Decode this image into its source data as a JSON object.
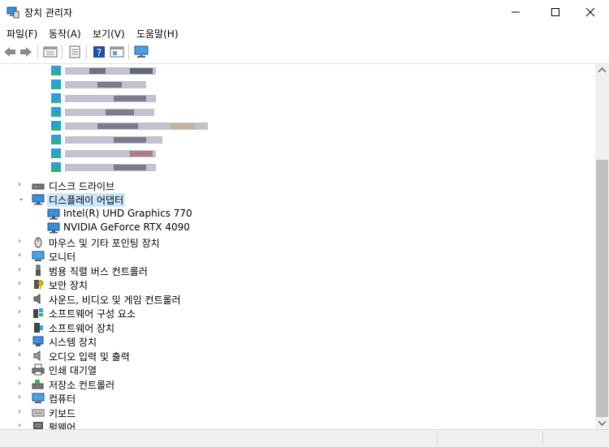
{
  "window": {
    "title": "장치 관리자",
    "minimize_symbol": "—",
    "maximize_symbol": "☐",
    "close_symbol": "✕"
  },
  "menu": [
    "파일(F)",
    "동작(A)",
    "보기(V)",
    "도움말(H)"
  ],
  "toolbar": {
    "buttons": [
      "back-icon",
      "forward-icon",
      "properties-sheet-icon",
      "view-icon",
      "help-icon",
      "update-driver-icon",
      "monitor-scan-icon"
    ]
  },
  "tree": {
    "blurred_items": [
      {
        "icon": "network-adapter-icon",
        "label": "(blurred)"
      },
      {
        "icon": "network-adapter-icon",
        "label": "(blurred)"
      },
      {
        "icon": "network-adapter-icon",
        "label": "(blurred)"
      },
      {
        "icon": "network-adapter-icon",
        "label": "(blurred)"
      },
      {
        "icon": "network-adapter-icon",
        "label": "(blurred)"
      },
      {
        "icon": "network-adapter-icon",
        "label": "(blurred)"
      },
      {
        "icon": "network-adapter-icon",
        "label": "(blurred)"
      },
      {
        "icon": "network-adapter-icon",
        "label": "(blurred)"
      }
    ],
    "categories": [
      {
        "label": "디스크 드라이브",
        "icon": "disk-drive-icon",
        "expanded": false
      },
      {
        "label": "디스플레이 어댑터",
        "icon": "display-adapter-icon",
        "expanded": true,
        "selected": true,
        "children": [
          "Intel(R) UHD Graphics 770",
          "NVIDIA GeForce RTX 4090"
        ]
      },
      {
        "label": "마우스 및 기타 포인팅 장치",
        "icon": "mouse-icon",
        "expanded": false
      },
      {
        "label": "모니터",
        "icon": "monitor-icon",
        "expanded": false
      },
      {
        "label": "범용 직렬 버스 컨트롤러",
        "icon": "usb-icon",
        "expanded": false
      },
      {
        "label": "보안 장치",
        "icon": "security-device-icon",
        "expanded": false
      },
      {
        "label": "사운드, 비디오 및 게임 컨트롤러",
        "icon": "speaker-icon",
        "expanded": false
      },
      {
        "label": "소프트웨어 구성 요소",
        "icon": "software-component-icon",
        "expanded": false
      },
      {
        "label": "소프트웨어 장치",
        "icon": "software-device-icon",
        "expanded": false
      },
      {
        "label": "시스템 장치",
        "icon": "system-device-icon",
        "expanded": false
      },
      {
        "label": "오디오 입력 및 출력",
        "icon": "audio-icon",
        "expanded": false
      },
      {
        "label": "인쇄 대기열",
        "icon": "printer-icon",
        "expanded": false
      },
      {
        "label": "저장소 컨트롤러",
        "icon": "storage-controller-icon",
        "expanded": false
      },
      {
        "label": "컴퓨터",
        "icon": "computer-icon",
        "expanded": false
      },
      {
        "label": "키보드",
        "icon": "keyboard-icon",
        "expanded": false
      },
      {
        "label": "펌웨어",
        "icon": "firmware-icon",
        "expanded": false
      }
    ]
  },
  "colors": {
    "selection": "#cce8ff",
    "accent": "#0078d7"
  }
}
